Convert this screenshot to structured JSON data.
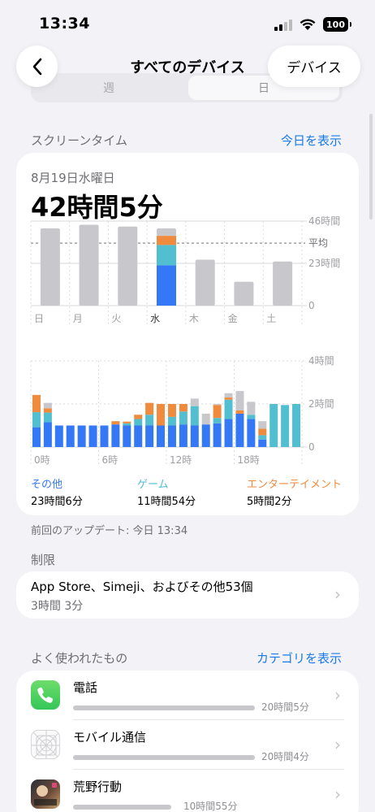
{
  "status_bar": {
    "time": "13:34",
    "battery": "100"
  },
  "nav": {
    "title": "すべてのデバイス",
    "devices_button": "デバイス",
    "segments": [
      "週",
      "日"
    ]
  },
  "screen_time": {
    "section_title": "スクリーンタイム",
    "show_today_link": "今日を表示",
    "date": "8月19日水曜日",
    "total": "42時間5分",
    "avg_label": "平均",
    "last_update": "前回のアップデート: 今日 13:34"
  },
  "categories": [
    {
      "name": "その他",
      "time": "23時間6分",
      "color": "#3478f6"
    },
    {
      "name": "ゲーム",
      "time": "11時間54分",
      "color": "#52bfd0"
    },
    {
      "name": "エンターテイメント",
      "time": "5時間2分",
      "color": "#f08a3c"
    }
  ],
  "limits": {
    "section_title": "制限",
    "title": "App Store、Simeji、およびその他53個",
    "time": "3時間 3分"
  },
  "most_used": {
    "section_title": "よく使われたもの",
    "show_categories_link": "カテゴリを表示",
    "apps": [
      {
        "name": "電話",
        "time": "20時間5分",
        "icon": "phone-icon",
        "fraction": 1.0
      },
      {
        "name": "モバイル通信",
        "time": "20時間4分",
        "icon": "cellular-placeholder-icon",
        "fraction": 0.998
      },
      {
        "name": "荒野行動",
        "time": "10時間55分",
        "icon": "game-icon",
        "fraction": 0.54
      }
    ]
  },
  "chart_data": [
    {
      "type": "bar",
      "categories": [
        "日",
        "月",
        "火",
        "水",
        "木",
        "金",
        "土"
      ],
      "series": [
        {
          "name": "その他",
          "values": [
            0,
            0,
            0,
            22,
            0,
            0,
            0
          ]
        },
        {
          "name": "ゲーム",
          "values": [
            0,
            0,
            0,
            11,
            0,
            0,
            0
          ]
        },
        {
          "name": "エンターテイメント",
          "values": [
            0,
            0,
            0,
            5,
            0,
            0,
            0
          ]
        },
        {
          "values": [
            42,
            44,
            43,
            4,
            25,
            13,
            24
          ]
        }
      ],
      "ylim": [
        0,
        46
      ],
      "yticks": [
        0,
        23,
        46
      ],
      "ytick_labels": [
        "0",
        "23時間",
        "46時間"
      ],
      "average": 34,
      "average_label": "平均",
      "highlight": "水"
    },
    {
      "type": "bar",
      "categories": [
        "0",
        "1",
        "2",
        "3",
        "4",
        "5",
        "6",
        "7",
        "8",
        "9",
        "10",
        "11",
        "12",
        "13",
        "14",
        "15",
        "16",
        "17",
        "18",
        "19",
        "20",
        "21",
        "22",
        "23"
      ],
      "x_tick_labels": [
        "0時",
        "6時",
        "12時",
        "18時"
      ],
      "series": [
        {
          "name": "その他",
          "values": [
            0.92,
            1.15,
            1.0,
            1.0,
            1.0,
            1.0,
            1.0,
            1.05,
            1.0,
            1.0,
            1.0,
            1.0,
            1.0,
            1.05,
            1.0,
            1.05,
            1.1,
            1.3,
            1.55,
            1.3,
            0.35,
            0,
            0,
            0
          ]
        },
        {
          "name": "ゲーム",
          "values": [
            0.7,
            0.45,
            0,
            0,
            0,
            0,
            0,
            0,
            0.1,
            0.3,
            0.5,
            0,
            0.4,
            0.6,
            0.9,
            0,
            0.25,
            0.9,
            0,
            0.2,
            0.2,
            2.0,
            1.95,
            2.0
          ]
        },
        {
          "name": "エンターテイメント",
          "values": [
            0.8,
            0.2,
            0,
            0,
            0,
            0,
            0,
            0.15,
            0.08,
            0.2,
            0.55,
            1.0,
            0.6,
            0.35,
            0,
            0,
            0.6,
            0.1,
            0.15,
            0,
            0.3,
            0,
            0,
            0
          ]
        },
        {
          "values": [
            0,
            0.25,
            0,
            0,
            0,
            0,
            0,
            0,
            0,
            0,
            0,
            0,
            0,
            0,
            0.35,
            0.5,
            0.05,
            0.2,
            0.9,
            0.6,
            0.35,
            0,
            0,
            0
          ]
        }
      ],
      "ylim": [
        0,
        4
      ],
      "yticks": [
        0,
        2,
        4
      ],
      "ytick_labels": [
        "0",
        "2時間",
        "4時間"
      ]
    }
  ]
}
